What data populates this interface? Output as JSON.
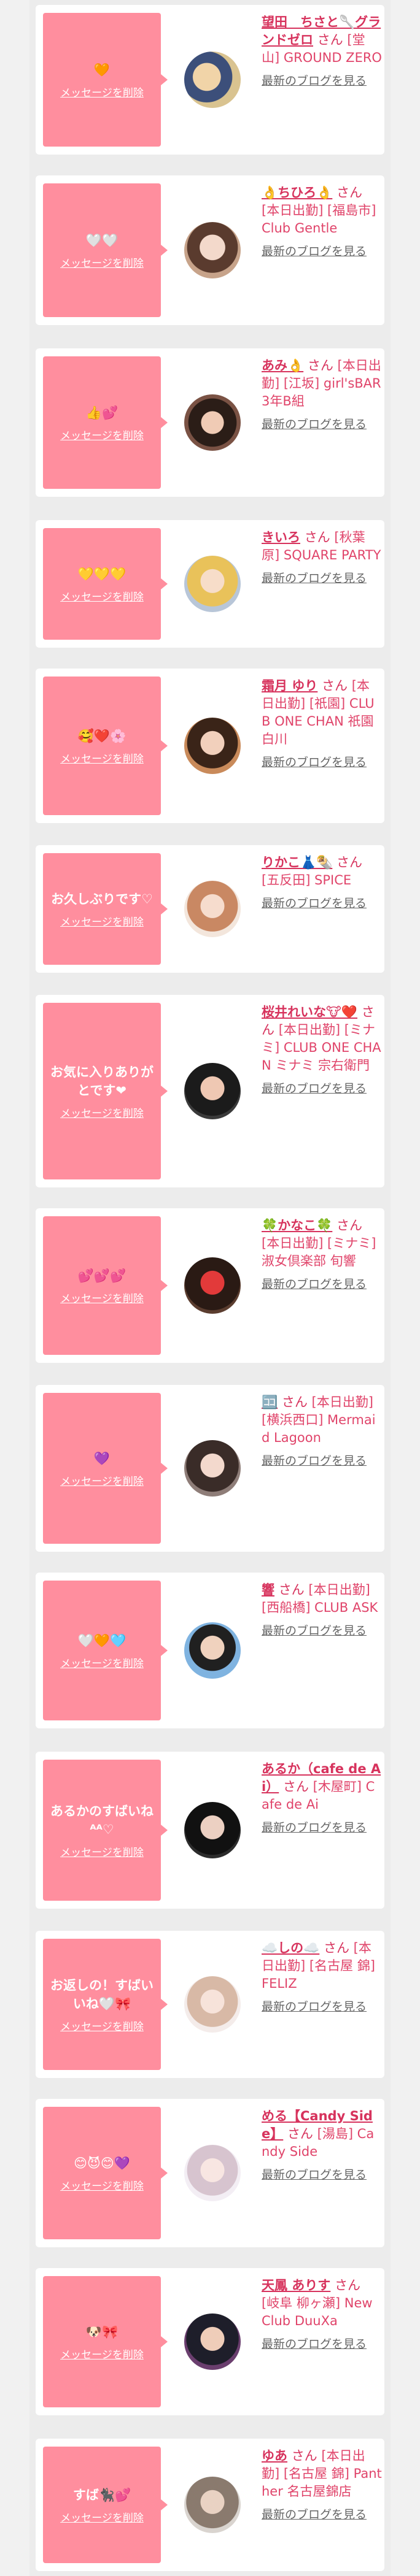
{
  "ui": {
    "delete_label": "メッセージを削除",
    "blog_label": "最新のブログを見る",
    "accent_color": "#ff8e9e",
    "name_color": "#d7335d"
  },
  "items": [
    {
      "message": "🧡",
      "name": "望田　ちさと🥄グランドゼロ",
      "san": "さん",
      "detail": "[堂山] GROUND ZERO",
      "avatar_icon": "avatar-photo"
    },
    {
      "message": "🤍🤍",
      "name": "👌ちひろ👌",
      "san": "さん",
      "detail": "[本日出勤] [福島市] Club Gentle",
      "avatar_icon": "avatar-photo"
    },
    {
      "message": "👍💕",
      "name": "あみ👌",
      "san": "さん",
      "detail": "[本日出勤] [江坂] girl'sBAR 3年B組",
      "avatar_icon": "avatar-photo"
    },
    {
      "message": "💛💛💛",
      "name": "きいろ",
      "san": "さん",
      "detail": "[秋葉原] SQUARE PARTY",
      "avatar_icon": "avatar-photo"
    },
    {
      "message": "🥰❤️🌸",
      "name": "霜月 ゆり",
      "san": "さん",
      "detail": "[本日出勤] [祇園] CLUB ONE CHAN 祇園白川",
      "avatar_icon": "avatar-photo"
    },
    {
      "message": "お久しぶりです♡",
      "name": "りかこ👗🌯",
      "san": "さん",
      "detail": "[五反田] SPICE",
      "avatar_icon": "avatar-photo"
    },
    {
      "message": "お気に入りありがとです❤",
      "name": "桜井れいな🐮❤️",
      "san": "さん",
      "detail": "[本日出勤] [ミナミ] CLUB ONE CHAN ミナミ 宗右衛門",
      "avatar_icon": "avatar-photo"
    },
    {
      "message": "💕💕💕",
      "name": "🍀かなこ🍀",
      "san": "さん",
      "detail": "[本日出勤] [ミナミ] 淑女倶楽部 旬響",
      "avatar_icon": "avatar-photo"
    },
    {
      "message": "💜",
      "name": "🈁",
      "san": "さん",
      "detail": "[本日出勤] [横浜西口] Mermaid Lagoon",
      "avatar_icon": "avatar-photo"
    },
    {
      "message": "🤍🧡🩵",
      "name": "響",
      "san": "さん",
      "detail": "[本日出勤] [西船橋] CLUB ASK",
      "avatar_icon": "avatar-photo"
    },
    {
      "message": "あるかのすばいね ᴬᴬ♡",
      "name": "あるか（cafe de Ai）",
      "san": "さん",
      "detail": "[木屋町] Cafe de Ai",
      "avatar_icon": "avatar-photo"
    },
    {
      "message": "お返しの！すばいいね🤍🎀",
      "name": "☁️しの☁️",
      "san": "さん",
      "detail": "[本日出勤] [名古屋 錦] FELIZ",
      "avatar_icon": "avatar-photo"
    },
    {
      "message": "😊😈😊💜",
      "name": "める【Candy Side】",
      "san": "さん",
      "detail": "[湯島] Candy Side",
      "avatar_icon": "avatar-photo"
    },
    {
      "message": "🐶🎀",
      "name": "天鳳 ありす",
      "san": "さん",
      "detail": "[岐阜 柳ヶ瀬] New Club DuuXa",
      "avatar_icon": "avatar-photo"
    },
    {
      "message": "すば🐈‍⬛💕",
      "name": "ゆあ",
      "san": "さん",
      "detail": "[本日出勤] [名古屋 錦] Panther 名古屋錦店",
      "avatar_icon": "avatar-photo"
    }
  ]
}
